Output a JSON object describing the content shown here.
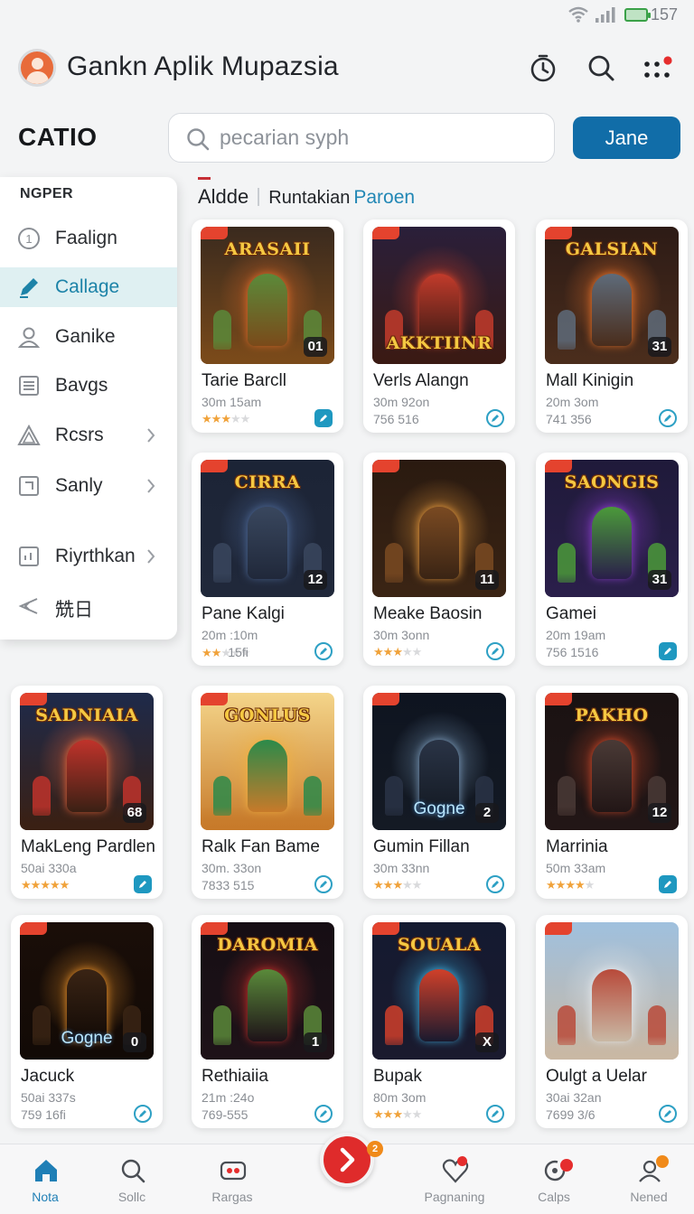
{
  "status_bar": {
    "time": "157"
  },
  "header": {
    "title": "Gankn Aplik Mupazsia"
  },
  "brand": "CATIO",
  "search": {
    "placeholder": "pecarian syph"
  },
  "action_button": "Jane",
  "menu": {
    "title": "NGPER",
    "items": [
      {
        "label": "Faalign",
        "icon": "circle-one-icon",
        "active": false,
        "chevron": false
      },
      {
        "label": "Callage",
        "icon": "pencil-icon",
        "active": true,
        "chevron": false
      },
      {
        "label": "Ganike",
        "icon": "user-icon",
        "active": false,
        "chevron": false
      },
      {
        "label": "Bavgs",
        "icon": "list-icon",
        "active": false,
        "chevron": false
      },
      {
        "label": "Rcsrs",
        "icon": "triangle-icon",
        "active": false,
        "chevron": true
      },
      {
        "label": "Sanly",
        "icon": "square-icon",
        "active": false,
        "chevron": true
      },
      {
        "label": "Riyrthkan",
        "icon": "chart-box-icon",
        "active": false,
        "chevron": true
      },
      {
        "label": "兟日",
        "icon": "share-icon",
        "active": false,
        "chevron": false
      }
    ]
  },
  "section": {
    "part_a": "Aldde",
    "part_b": "Runtakian",
    "part_c": "Paroen"
  },
  "games": [
    {
      "name": "Tarie Barcll",
      "meta": "30m 15am",
      "stars": 3,
      "sub": "",
      "badge": "01",
      "art_title": "ARASAII",
      "art_sub": "",
      "filled": true
    },
    {
      "name": "Verls Alangn",
      "meta": "30m 92on",
      "stars": 0,
      "sub": "756 516",
      "badge": "",
      "art_title": "AKKTIINR",
      "art_sub": "",
      "filled": false
    },
    {
      "name": "Mall Kinigin",
      "meta": "20m 3om",
      "stars": 0,
      "sub": "741 356",
      "badge": "31",
      "art_title": "GALSIAN",
      "art_sub": "",
      "filled": false
    },
    {
      "name": "Pane Kalgi",
      "meta": "20m :10m",
      "stars": 2,
      "sub": "15fi",
      "badge": "12",
      "art_title": "CIRRA",
      "art_sub": "",
      "filled": false
    },
    {
      "name": "Meake Baosin",
      "meta": "30m 3onn",
      "stars": 3,
      "sub": "",
      "badge": "11",
      "art_title": "",
      "art_sub": "",
      "filled": false
    },
    {
      "name": "Gamei",
      "meta": "20m 19am",
      "stars": 0,
      "sub": "756 1516",
      "badge": "31",
      "art_title": "SAONGIS",
      "art_sub": "",
      "filled": true
    },
    {
      "name": "MakLeng Pardlen",
      "meta": "50ai 330a",
      "stars": 5,
      "sub": "",
      "badge": "68",
      "art_title": "SADNIAIA",
      "art_sub": "",
      "filled": true
    },
    {
      "name": "Ralk Fan Bame",
      "meta": "30m. 33on",
      "stars": 0,
      "sub": "7833 515",
      "badge": "",
      "art_title": "GONLUS",
      "art_sub": "",
      "filled": false
    },
    {
      "name": "Gumin Fillan",
      "meta": "30m 33nn",
      "stars": 3,
      "sub": "",
      "badge": "2",
      "art_title": "",
      "art_sub": "Gogne",
      "filled": false
    },
    {
      "name": "Marrinia",
      "meta": "50m 33am",
      "stars": 4,
      "sub": "",
      "badge": "12",
      "art_title": "PAKHO",
      "art_sub": "",
      "filled": true
    },
    {
      "name": "Jacuck",
      "meta": "50ai 337s",
      "stars": 0,
      "sub": "759 16fi",
      "badge": "0",
      "art_title": "",
      "art_sub": "Gogne",
      "filled": false
    },
    {
      "name": "Rethiaiia",
      "meta": "21m :24o",
      "stars": 0,
      "sub": "769-555",
      "badge": "1",
      "art_title": "DAROMIA",
      "art_sub": "",
      "filled": false
    },
    {
      "name": "Bupak",
      "meta": "80m 3om",
      "stars": 3,
      "sub": "",
      "badge": "X",
      "art_title": "SOUALA",
      "art_sub": "",
      "filled": false
    },
    {
      "name": "Oulgt a Uelar",
      "meta": "30ai 32an",
      "stars": 0,
      "sub": "7699 3/6",
      "badge": "",
      "art_title": "",
      "art_sub": "",
      "filled": false
    }
  ],
  "bottom_nav": {
    "items": [
      {
        "label": "Nota",
        "icon": "home-icon",
        "active": true
      },
      {
        "label": "Sollc",
        "icon": "search-icon",
        "active": false
      },
      {
        "label": "Rargas",
        "icon": "gamepad-icon",
        "active": false
      },
      {
        "label": "Pagnaning",
        "icon": "heart-icon",
        "active": false
      },
      {
        "label": "Calps",
        "icon": "refresh-icon",
        "active": false
      },
      {
        "label": "Nened",
        "icon": "profile-icon",
        "active": false
      }
    ],
    "fab_badge": "2"
  },
  "colors": {
    "accent": "#116da8",
    "link": "#2187b5",
    "active_menu_bg": "#dff0f2",
    "fab": "#df2b2b",
    "star": "#f0a23a"
  }
}
